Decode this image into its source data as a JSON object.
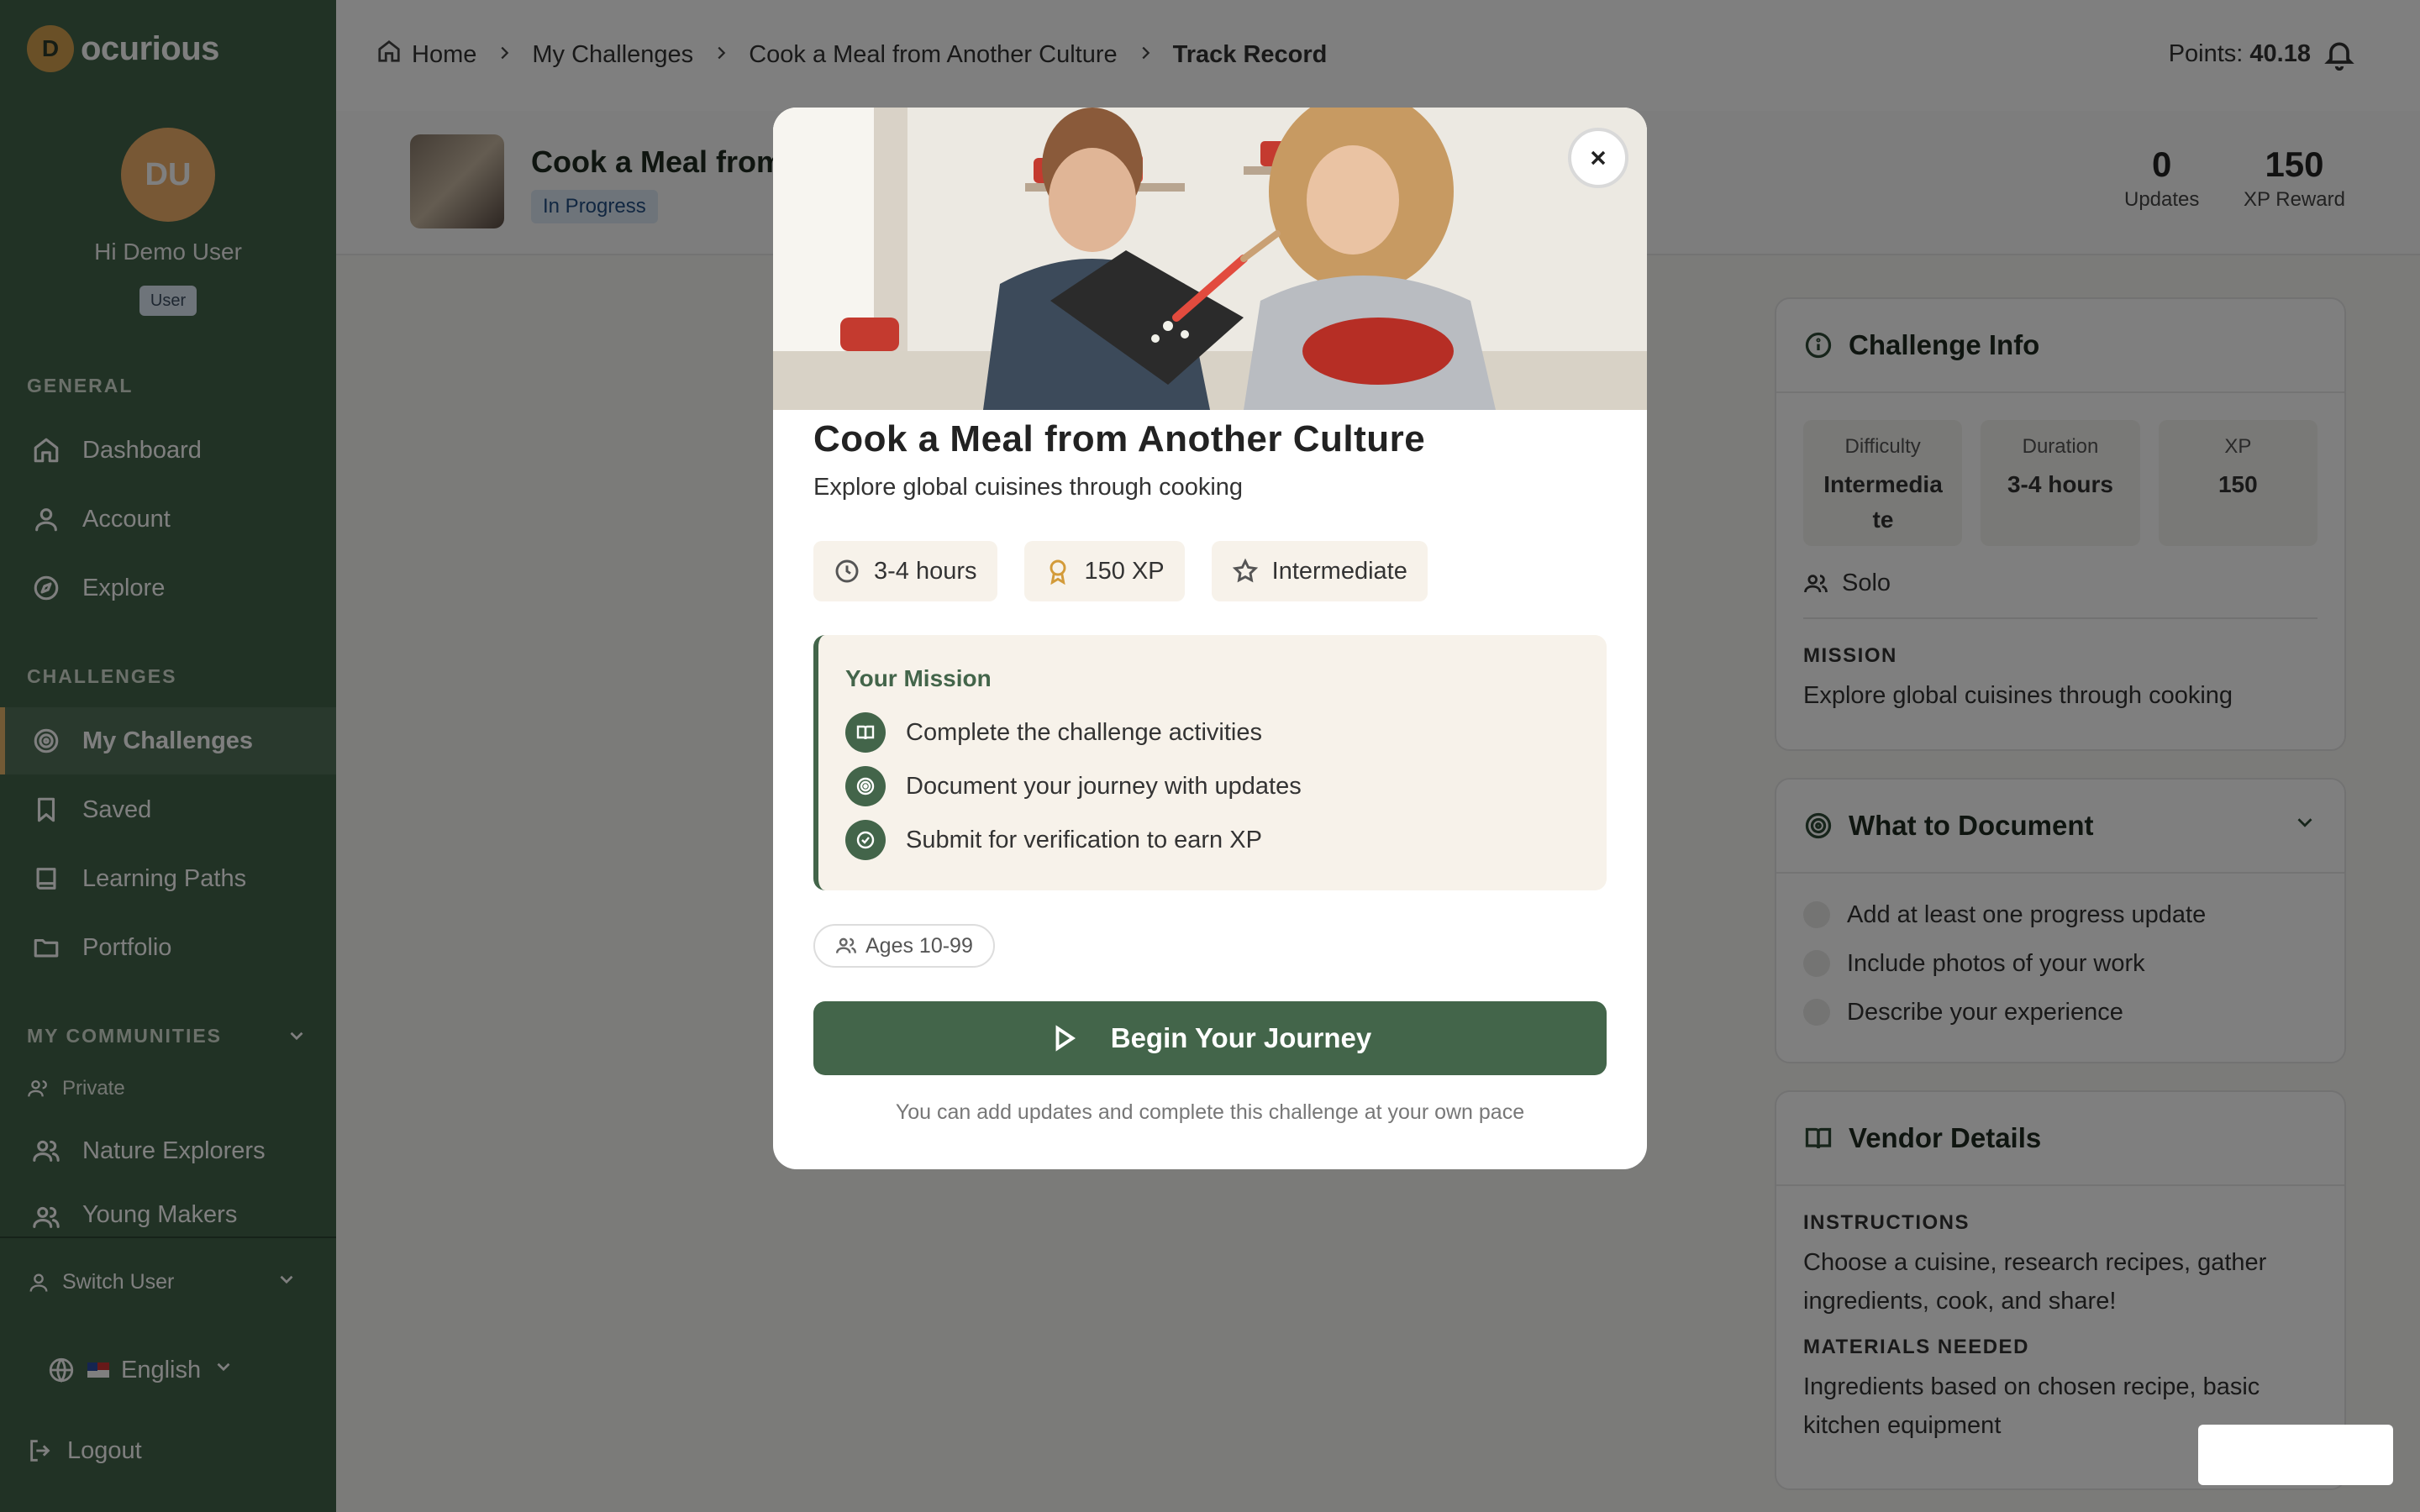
{
  "brand": {
    "mark": "D",
    "name": "ocurious"
  },
  "user": {
    "initials": "DU",
    "greeting": "Hi Demo User",
    "role": "User"
  },
  "sidebar": {
    "general_label": "GENERAL",
    "general": [
      {
        "label": "Dashboard",
        "icon": "home-icon"
      },
      {
        "label": "Account",
        "icon": "user-icon"
      },
      {
        "label": "Explore",
        "icon": "compass-icon"
      }
    ],
    "challenges_label": "CHALLENGES",
    "challenges": [
      {
        "label": "My Challenges",
        "icon": "target-icon",
        "active": true
      },
      {
        "label": "Saved",
        "icon": "bookmark-icon"
      },
      {
        "label": "Learning Paths",
        "icon": "book-icon"
      },
      {
        "label": "Portfolio",
        "icon": "folder-icon"
      }
    ],
    "communities_label": "MY COMMUNITIES",
    "private_label": "Private",
    "communities": [
      {
        "label": "Nature Explorers",
        "icon": "users-icon"
      },
      {
        "label": "Young Makers",
        "icon": "users-icon"
      }
    ],
    "switch_user": "Switch User",
    "language": "English",
    "logout": "Logout"
  },
  "breadcrumb": [
    "Home",
    "My Challenges",
    "Cook a Meal from Another Culture",
    "Track Record"
  ],
  "points": {
    "label": "Points:",
    "value": "40.18"
  },
  "challenge": {
    "title_visible": "Cook a Meal from",
    "status": "In Progress",
    "updates": {
      "value": "0",
      "label": "Updates"
    },
    "xp": {
      "value": "150",
      "label": "XP Reward"
    }
  },
  "challenge_info": {
    "title": "Challenge Info",
    "difficulty": {
      "label": "Difficulty",
      "value": "Intermedia te"
    },
    "duration": {
      "label": "Duration",
      "value": "3-4 hours"
    },
    "xp": {
      "label": "XP",
      "value": "150"
    },
    "mode": "Solo",
    "mission_label": "MISSION",
    "mission": "Explore global cuisines through cooking"
  },
  "what_to_document": {
    "title": "What to Document",
    "items": [
      "Add at least one progress update",
      "Include photos of your work",
      "Describe your experience"
    ]
  },
  "vendor": {
    "title": "Vendor Details",
    "instructions_label": "INSTRUCTIONS",
    "instructions": "Choose a cuisine, research recipes, gather ingredients, cook, and share!",
    "materials_label": "MATERIALS NEEDED",
    "materials": "Ingredients based on chosen recipe, basic kitchen equipment"
  },
  "modal": {
    "title": "Cook a Meal from Another Culture",
    "subtitle": "Explore global cuisines through cooking",
    "chips": [
      "3-4 hours",
      "150 XP",
      "Intermediate"
    ],
    "mission_title": "Your Mission",
    "mission_items": [
      "Complete the challenge activities",
      "Document your journey with updates",
      "Submit for verification to earn XP"
    ],
    "ages": "Ages 10-99",
    "cta": "Begin Your Journey",
    "note": "You can add updates and complete this challenge at your own pace"
  }
}
